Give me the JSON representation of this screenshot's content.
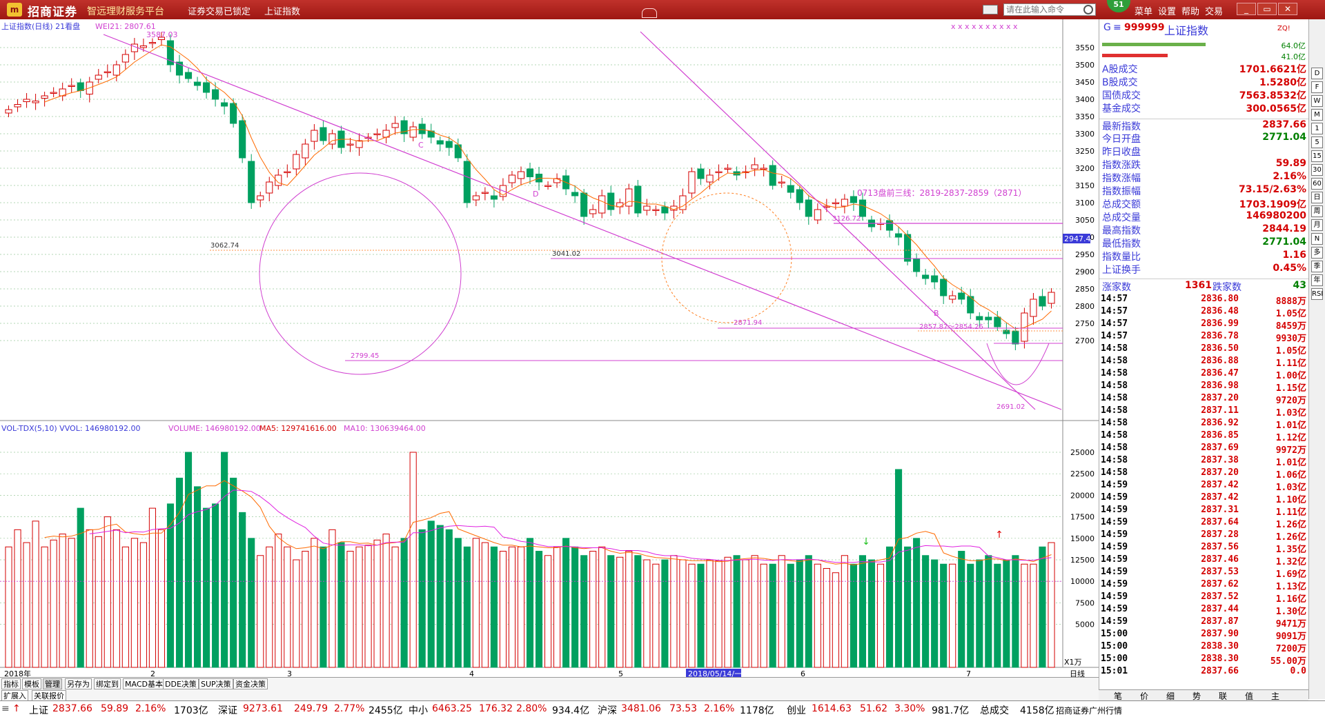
{
  "titlebar": {
    "logo": "m",
    "brand": "招商证券",
    "slogan": "智远理财服务平台",
    "status": "证券交易已锁定",
    "index_name": "上证指数",
    "cmd_placeholder": "请在此输入命令",
    "badge": "51",
    "menus": [
      "菜单",
      "设置",
      "帮助",
      "交易"
    ]
  },
  "kline": {
    "legend_title": "上证指数(日线) 21看盘",
    "legend_wei": "WEI21: 2807.61",
    "annot_high": "3587.03",
    "annot_left_low": "3062.74",
    "annot_mid_low": "3041.02",
    "annot_circle_low": "2799.45",
    "annot_circle2_low": "2871.94",
    "annot_c": "C",
    "annot_d": "D",
    "annot_b": "B",
    "annot_3126": "3126.72",
    "annot_text": "0713盘前三线：2819-2837-2859（2871）",
    "annot_2857": "2857.87～2854.26",
    "annot_bottom_low": "2691.02",
    "price_tag": "2947.4",
    "y_ticks": [
      "3550",
      "3500",
      "3450",
      "3400",
      "3350",
      "3300",
      "3250",
      "3200",
      "3150",
      "3100",
      "3050",
      "3000",
      "2950",
      "2900",
      "2850",
      "2800",
      "2750",
      "2700"
    ],
    "stars": "x x x    x x x x x x x"
  },
  "volume": {
    "legend": "VOL-TDX(5,10)  VVOL: 146980192.00",
    "legend_volume": "VOLUME: 146980192.00",
    "legend_ma5": "MA5: 129741616.00",
    "legend_ma10": "MA10: 130639464.00",
    "y_ticks": [
      "25000",
      "22500",
      "20000",
      "17500",
      "15000",
      "12500",
      "10000",
      "7500",
      "5000"
    ],
    "unit": "X1万"
  },
  "xaxis": {
    "labels": [
      "2018年",
      "2",
      "3",
      "4",
      "5",
      "6",
      "7"
    ],
    "highlight": "2018/05/14/一",
    "right_label": "日线"
  },
  "bottom_tabs": [
    "指标",
    "模板",
    "管理",
    "另存为",
    "绑定到",
    "MACD基本",
    "DDE决策",
    "SUP决策",
    "资金决策"
  ],
  "bottom_tabs2": [
    "扩展入",
    "关联报价"
  ],
  "right": {
    "code_prefix": "G",
    "code": "999999",
    "name": "上证指数",
    "tag": "ZQ!",
    "bar1_val": "64.0亿",
    "bar2_val": "41.0亿",
    "rows1": [
      {
        "k": "A股成交",
        "v": "1701.6621亿"
      },
      {
        "k": "B股成交",
        "v": "1.5280亿"
      },
      {
        "k": "国债成交",
        "v": "7563.8532亿"
      },
      {
        "k": "基金成交",
        "v": "300.0565亿"
      }
    ],
    "rows2": [
      {
        "k": "最新指数",
        "v": "2837.66",
        "c": "up"
      },
      {
        "k": "今日开盘",
        "v": "2771.04",
        "c": "down"
      },
      {
        "k": "昨日收盘",
        "v": "",
        "c": ""
      },
      {
        "k": "指数涨跌",
        "v": "59.89",
        "c": "up"
      },
      {
        "k": "指数涨幅",
        "v": "2.16%",
        "c": "up"
      },
      {
        "k": "指数振幅",
        "v": "73.15/2.63%",
        "c": "up"
      },
      {
        "k": "总成交额",
        "v": "1703.1909亿",
        "c": "up"
      },
      {
        "k": "总成交量",
        "v": "146980200",
        "c": "up"
      },
      {
        "k": "最高指数",
        "v": "2844.19",
        "c": "up"
      },
      {
        "k": "最低指数",
        "v": "2771.04",
        "c": "down"
      },
      {
        "k": "指数量比",
        "v": "1.16",
        "c": "up"
      },
      {
        "k": "上证换手",
        "v": "0.45%",
        "c": "up"
      }
    ],
    "rise_label": "涨家数",
    "rise": "1361",
    "fall_label": "跌家数",
    "fall": "43",
    "ticks": [
      [
        "14:57",
        "2836.80",
        "8888万"
      ],
      [
        "14:57",
        "2836.48",
        "1.05亿"
      ],
      [
        "14:57",
        "2836.99",
        "8459万"
      ],
      [
        "14:57",
        "2836.78",
        "9930万"
      ],
      [
        "14:58",
        "2836.50",
        "1.05亿"
      ],
      [
        "14:58",
        "2836.88",
        "1.11亿"
      ],
      [
        "14:58",
        "2836.47",
        "1.00亿"
      ],
      [
        "14:58",
        "2836.98",
        "1.15亿"
      ],
      [
        "14:58",
        "2837.20",
        "9720万"
      ],
      [
        "14:58",
        "2837.11",
        "1.03亿"
      ],
      [
        "14:58",
        "2836.92",
        "1.01亿"
      ],
      [
        "14:58",
        "2836.85",
        "1.12亿"
      ],
      [
        "14:58",
        "2837.69",
        "9972万"
      ],
      [
        "14:58",
        "2837.38",
        "1.01亿"
      ],
      [
        "14:58",
        "2837.20",
        "1.06亿"
      ],
      [
        "14:59",
        "2837.42",
        "1.03亿"
      ],
      [
        "14:59",
        "2837.42",
        "1.10亿"
      ],
      [
        "14:59",
        "2837.31",
        "1.11亿"
      ],
      [
        "14:59",
        "2837.64",
        "1.26亿"
      ],
      [
        "14:59",
        "2837.28",
        "1.26亿"
      ],
      [
        "14:59",
        "2837.56",
        "1.35亿"
      ],
      [
        "14:59",
        "2837.46",
        "1.32亿"
      ],
      [
        "14:59",
        "2837.53",
        "1.69亿"
      ],
      [
        "14:59",
        "2837.62",
        "1.13亿"
      ],
      [
        "14:59",
        "2837.52",
        "1.16亿"
      ],
      [
        "14:59",
        "2837.44",
        "1.30亿"
      ],
      [
        "14:59",
        "2837.87",
        "9471万"
      ],
      [
        "15:00",
        "2837.90",
        "9091万"
      ],
      [
        "15:00",
        "2838.30",
        "7200万"
      ],
      [
        "15:00",
        "2838.30",
        "55.00万"
      ],
      [
        "15:01",
        "2837.66",
        "0.0"
      ]
    ],
    "tabs": [
      "笔",
      "价",
      "细",
      "势",
      "联",
      "值",
      "主"
    ]
  },
  "toolbar_icons": [
    "D",
    "F",
    "W",
    "M",
    "1",
    "5",
    "15",
    "30",
    "60",
    "日",
    "周",
    "月",
    "N",
    "多",
    "季",
    "年",
    "RSI"
  ],
  "statusbar": {
    "sh_label": "上证",
    "sh_price": "2837.66",
    "sh_chg": "59.89",
    "sh_pct": "2.16%",
    "sh_amt": "1703亿",
    "sz_label": "深证",
    "sz_price": "9273.61",
    "sz_chg": "249.79",
    "sz_pct": "2.77%",
    "sz_amt": "2455亿",
    "zx_label": "中小",
    "zx_price": "6463.25",
    "zx_chg": "176.32",
    "zx_pct": "2.80%",
    "zx_amt": "934.4亿",
    "hs_label": "沪深",
    "hs_price": "3481.06",
    "hs_chg": "73.53",
    "hs_pct": "2.16%",
    "hs_amt": "1178亿",
    "cy_label": "创业",
    "cy_price": "1614.63",
    "cy_chg": "51.62",
    "cy_pct": "3.30%",
    "cy_amt": "981.7亿",
    "total_label": "总成交",
    "total": "4158亿",
    "broker": "招商证券广州行情"
  },
  "colors": {
    "up": "#d40000",
    "down": "#00a060",
    "trend": "#d03cd0",
    "ma": "#ff6a00",
    "volma": "#e020e0"
  }
}
